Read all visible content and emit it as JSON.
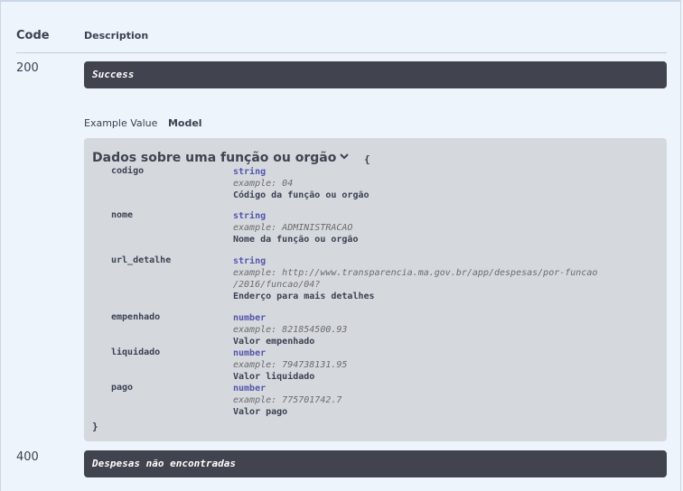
{
  "table": {
    "col_code": "Code",
    "col_description": "Description"
  },
  "responses": [
    {
      "code": "200",
      "description": "Success"
    },
    {
      "code": "400",
      "description": "Despesas não encontradas"
    }
  ],
  "tabs": {
    "example_value": "Example Value",
    "model": "Model"
  },
  "model": {
    "title": "Dados sobre uma função ou orgão",
    "open_brace": "{",
    "close_brace": "}",
    "properties": [
      {
        "name": "codigo",
        "type": "string",
        "example": "example: 04",
        "description": "Código da função ou orgão"
      },
      {
        "name": "nome",
        "type": "string",
        "example": "example: ADMINISTRACAO",
        "description": "Nome da função ou orgão"
      },
      {
        "name": "url_detalhe",
        "type": "string",
        "example": "example: http://www.transparencia.ma.gov.br/app/despesas/por-funcao",
        "example_cont": "/2016/funcao/04?",
        "description": "Enderço para mais detalhes"
      },
      {
        "name": "empenhado",
        "type": "number",
        "example": "example: 821854500.93",
        "description": "Valor empenhado"
      },
      {
        "name": "liquidado",
        "type": "number",
        "example": "example: 794738131.95",
        "description": "Valor liquidado"
      },
      {
        "name": "pago",
        "type": "number",
        "example": "example: 775701742.7",
        "description": "Valor pago"
      }
    ]
  }
}
